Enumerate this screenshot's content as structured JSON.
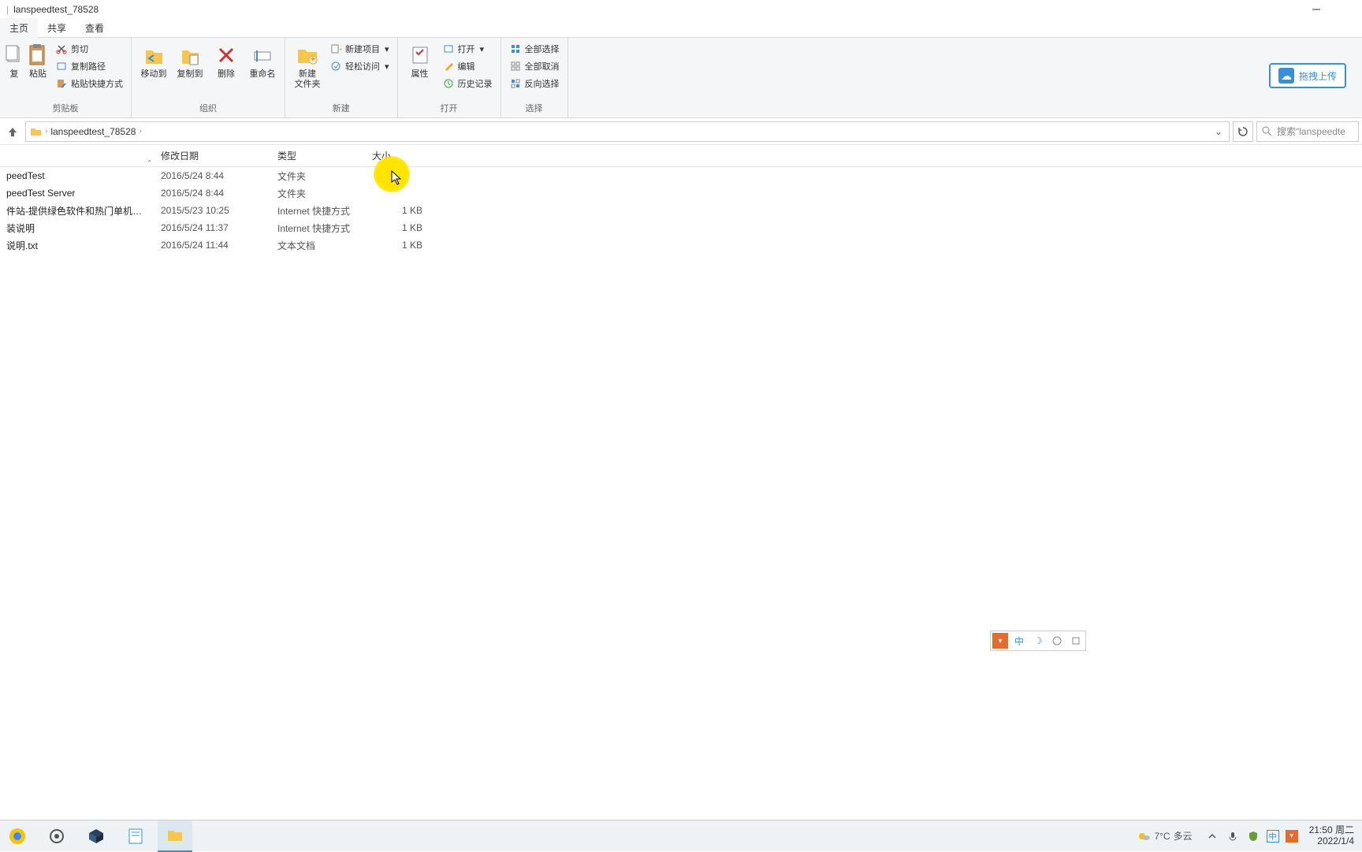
{
  "window": {
    "title": "lanspeedtest_78528"
  },
  "tabs": {
    "home": "主页",
    "share": "共享",
    "view": "查看"
  },
  "ribbon": {
    "clipboard": {
      "copy": "复",
      "paste": "粘贴",
      "cut": "剪切",
      "copypath": "复制路径",
      "pasteshortcut": "粘贴快捷方式",
      "group": "剪贴板"
    },
    "organize": {
      "moveto": "移动到",
      "copyto": "复制到",
      "delete": "删除",
      "rename": "重命名",
      "group": "组织"
    },
    "new": {
      "newfolder": "新建\n文件夹",
      "newitem": "新建项目",
      "easyaccess": "轻松访问",
      "group": "新建"
    },
    "open": {
      "properties": "属性",
      "open": "打开",
      "edit": "编辑",
      "history": "历史记录",
      "group": "打开"
    },
    "select": {
      "selectall": "全部选择",
      "selectnone": "全部取消",
      "invert": "反向选择",
      "group": "选择"
    },
    "cloud": "拖拽上传"
  },
  "address": {
    "folder": "lanspeedtest_78528"
  },
  "search": {
    "placeholder": "搜索\"lanspeedte"
  },
  "columns": {
    "date": "修改日期",
    "type": "类型",
    "size": "大小"
  },
  "rows": [
    {
      "name": "peedTest",
      "date": "2016/5/24 8:44",
      "type": "文件夹",
      "size": ""
    },
    {
      "name": "peedTest Server",
      "date": "2016/5/24 8:44",
      "type": "文件夹",
      "size": ""
    },
    {
      "name": "件站-提供绿色软件和热门单机游…",
      "date": "2015/5/23 10:25",
      "type": "Internet 快捷方式",
      "size": "1 KB"
    },
    {
      "name": "装说明",
      "date": "2016/5/24 11:37",
      "type": "Internet 快捷方式",
      "size": "1 KB"
    },
    {
      "name": "说明.txt",
      "date": "2016/5/24 11:44",
      "type": "文本文档",
      "size": "1 KB"
    }
  ],
  "taskbar": {
    "weather_temp": "7°C",
    "weather_desc": "多云",
    "time": "21:50",
    "day": "周二",
    "date": "2022/1/4",
    "ime": "中"
  }
}
